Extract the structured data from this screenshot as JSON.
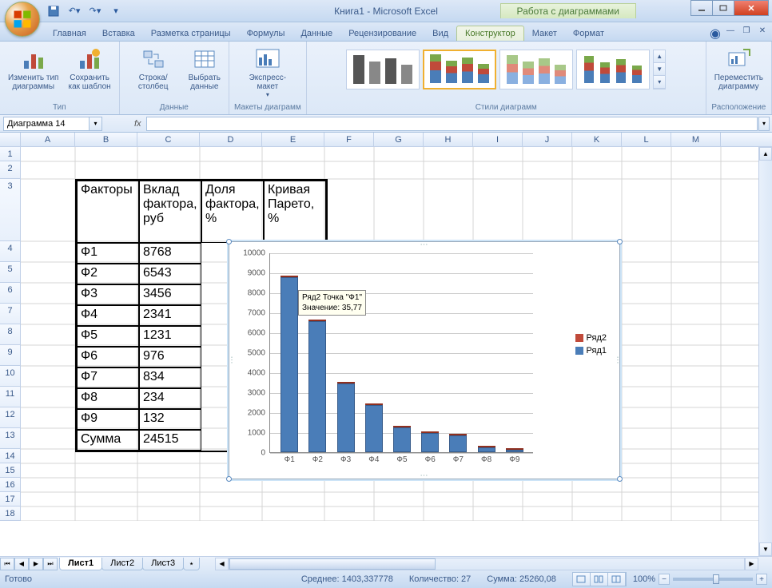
{
  "titlebar": {
    "title": "Книга1 - Microsoft Excel",
    "chart_tools": "Работа с диаграммами"
  },
  "tabs": {
    "home": "Главная",
    "insert": "Вставка",
    "layout": "Разметка страницы",
    "formulas": "Формулы",
    "data_tab": "Данные",
    "review": "Рецензирование",
    "view": "Вид",
    "design": "Конструктор",
    "layout2": "Макет",
    "format": "Формат"
  },
  "ribbon": {
    "type_group": "Тип",
    "change_type": "Изменить тип\nдиаграммы",
    "save_template": "Сохранить\nкак шаблон",
    "data_group": "Данные",
    "switch_rc": "Строка/столбец",
    "select_data": "Выбрать\nданные",
    "layouts_group": "Макеты диаграмм",
    "express_layout": "Экспресс-макет",
    "styles_group": "Стили диаграмм",
    "location_group": "Расположение",
    "move_chart": "Переместить\nдиаграмму"
  },
  "namebox": "Диаграмма 14",
  "columns": [
    "A",
    "B",
    "C",
    "D",
    "E",
    "F",
    "G",
    "H",
    "I",
    "J",
    "K",
    "L",
    "M"
  ],
  "table": {
    "headers": {
      "b": "Факторы",
      "c": "Вклад фактора, руб",
      "d": "Доля фактора, %",
      "e": "Кривая Парето, %"
    },
    "rows": [
      {
        "b": "Ф1",
        "c": "8768"
      },
      {
        "b": "Ф2",
        "c": "6543"
      },
      {
        "b": "Ф3",
        "c": "3456"
      },
      {
        "b": "Ф4",
        "c": "2341"
      },
      {
        "b": "Ф5",
        "c": "1231"
      },
      {
        "b": "Ф6",
        "c": "976"
      },
      {
        "b": "Ф7",
        "c": "834"
      },
      {
        "b": "Ф8",
        "c": "234"
      },
      {
        "b": "Ф9",
        "c": "132"
      },
      {
        "b": "Сумма",
        "c": "24515"
      }
    ]
  },
  "chart_data": {
    "type": "bar",
    "categories": [
      "Ф1",
      "Ф2",
      "Ф3",
      "Ф4",
      "Ф5",
      "Ф6",
      "Ф7",
      "Ф8",
      "Ф9"
    ],
    "series": [
      {
        "name": "Ряд1",
        "values": [
          8768,
          6543,
          3456,
          2341,
          1231,
          976,
          834,
          234,
          132
        ],
        "color": "#4a7db8"
      },
      {
        "name": "Ряд2",
        "values": [
          35.77,
          26.69,
          14.1,
          9.55,
          5.02,
          3.98,
          3.4,
          0.95,
          0.54
        ],
        "color": "#c04a3a"
      }
    ],
    "ylim": [
      0,
      10000
    ],
    "yticks": [
      0,
      1000,
      2000,
      3000,
      4000,
      5000,
      6000,
      7000,
      8000,
      9000,
      10000
    ],
    "tooltip": {
      "line1": "Ряд2 Точка \"Ф1\"",
      "line2": "Значение: 35,77"
    },
    "legend": [
      "Ряд2",
      "Ряд1"
    ]
  },
  "sheets": {
    "s1": "Лист1",
    "s2": "Лист2",
    "s3": "Лист3"
  },
  "statusbar": {
    "ready": "Готово",
    "avg": "Среднее: 1403,337778",
    "count": "Количество: 27",
    "sum": "Сумма: 25260,08",
    "zoom": "100%"
  }
}
